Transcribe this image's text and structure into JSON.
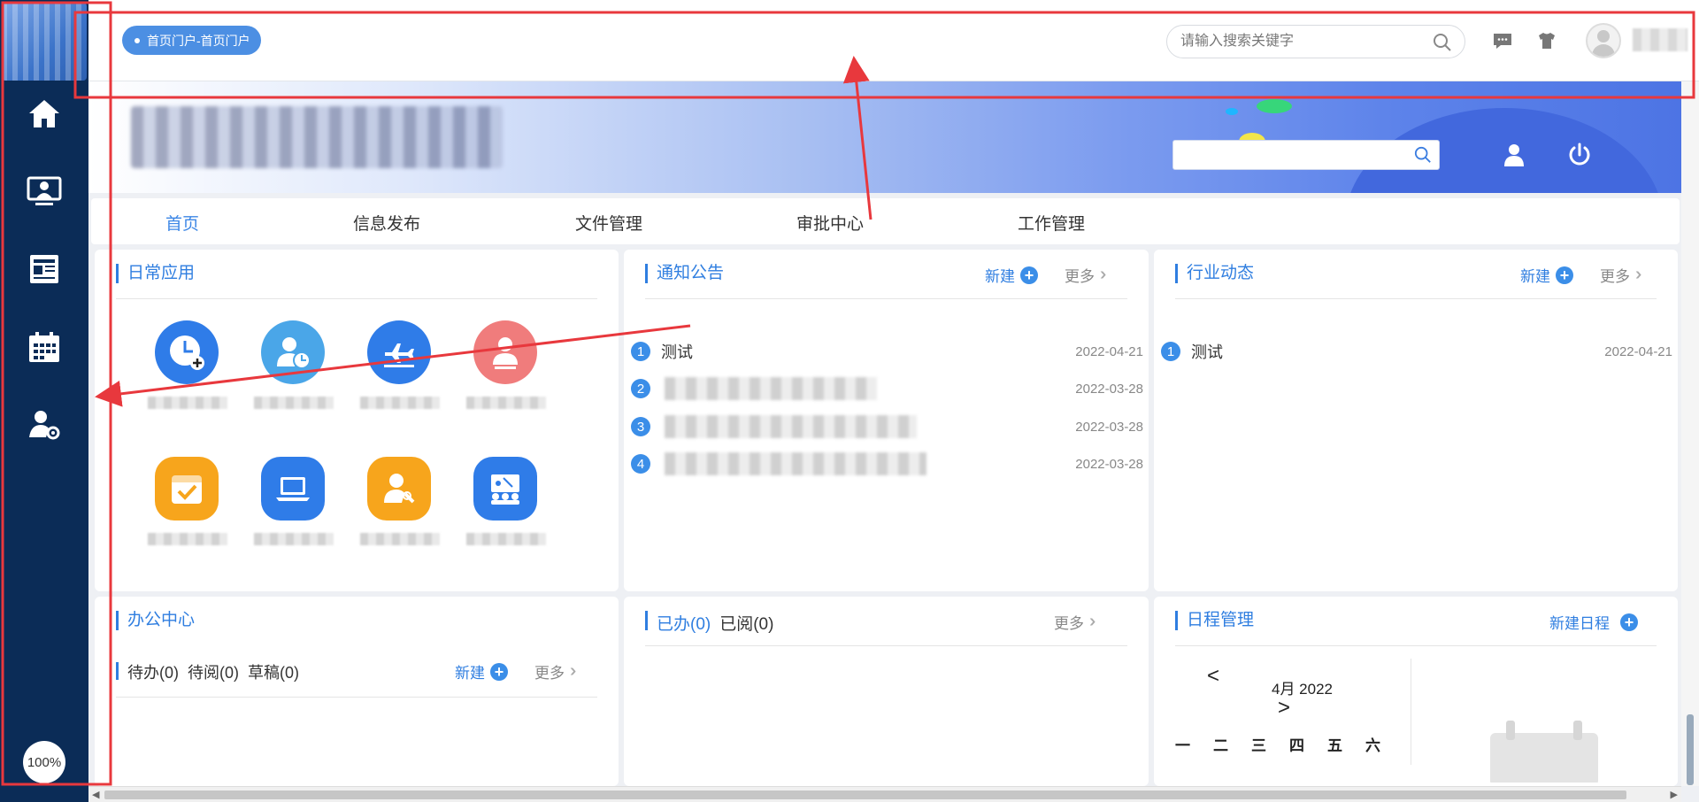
{
  "topbar": {
    "tab_label": "首页门户-首页门户",
    "search_placeholder": "请输入搜索关键字"
  },
  "sidebar": {
    "items": [
      {
        "icon": "home-icon"
      },
      {
        "icon": "monitor-user-icon"
      },
      {
        "icon": "news-icon"
      },
      {
        "icon": "calendar-icon"
      },
      {
        "icon": "user-settings-icon"
      }
    ],
    "zoom": "100%"
  },
  "nav": {
    "items": [
      "首页",
      "信息发布",
      "文件管理",
      "审批中心",
      "工作管理"
    ]
  },
  "daily_apps": {
    "title": "日常应用"
  },
  "notices": {
    "title": "通知公告",
    "new_label": "新建",
    "more_label": "更多",
    "rows": [
      {
        "num": "1",
        "title": "测试",
        "date": "2022-04-21"
      },
      {
        "num": "2",
        "title": "",
        "date": "2022-03-28"
      },
      {
        "num": "3",
        "title": "",
        "date": "2022-03-28"
      },
      {
        "num": "4",
        "title": "",
        "date": "2022-03-28"
      }
    ]
  },
  "industry": {
    "title": "行业动态",
    "new_label": "新建",
    "more_label": "更多",
    "rows": [
      {
        "num": "1",
        "title": "测试",
        "date": "2022-04-21"
      }
    ]
  },
  "office": {
    "title": "办公中心",
    "tabs": [
      "待办(0)",
      "待阅(0)",
      "草稿(0)"
    ],
    "new_label": "新建",
    "more_label": "更多"
  },
  "done": {
    "tab_done": "已办(0)",
    "tab_read": "已阅(0)",
    "more_label": "更多"
  },
  "schedule": {
    "title": "日程管理",
    "new_label": "新建日程",
    "prev": "<",
    "next": ">",
    "month": "4月 2022",
    "weekdays": [
      "一",
      "二",
      "三",
      "四",
      "五",
      "六"
    ]
  },
  "colors": {
    "sidebar": "#0b2c57",
    "accent": "#2f7ee0",
    "annotation": "#e8383d"
  }
}
